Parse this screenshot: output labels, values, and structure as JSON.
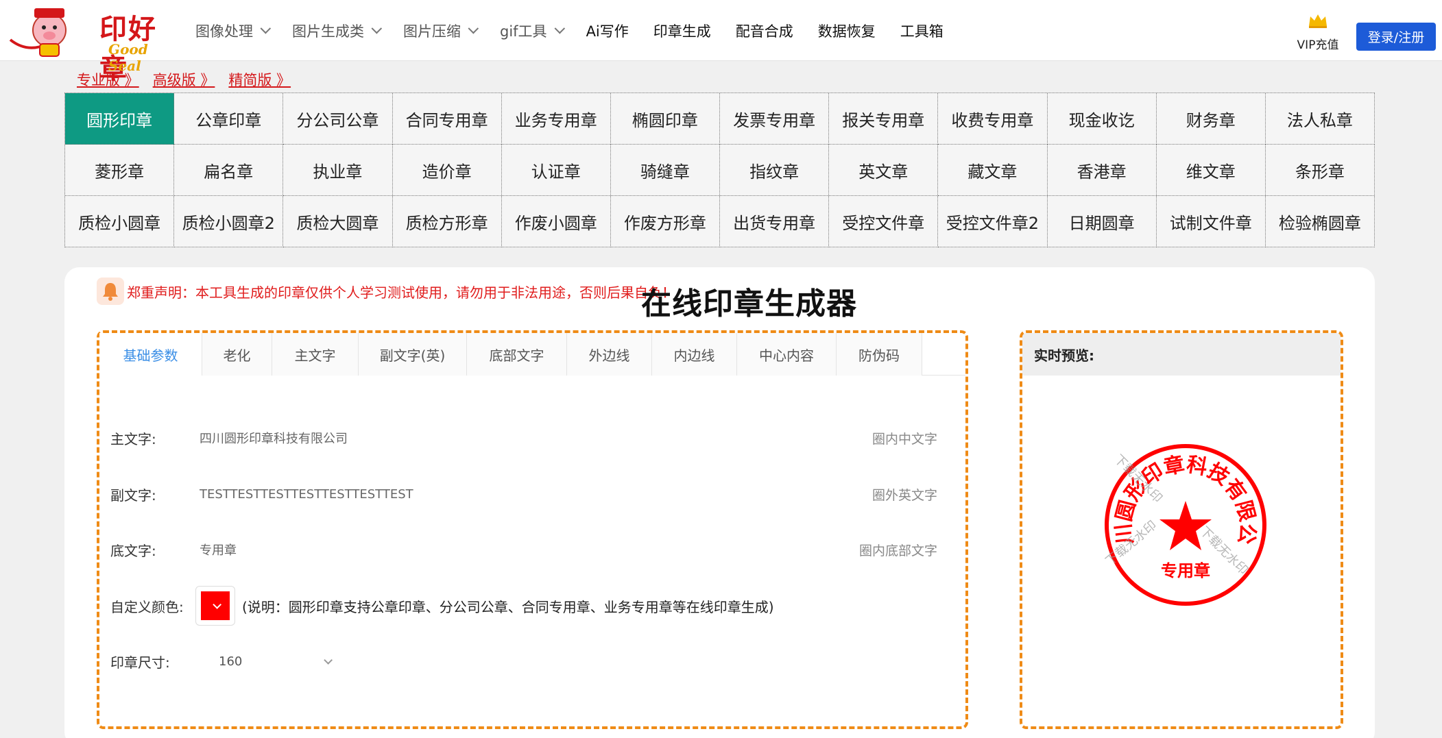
{
  "header": {
    "logo_title": "印好章",
    "logo_sub": "Good Seal",
    "nav": [
      {
        "label": "图像处理",
        "dropdown": true
      },
      {
        "label": "图片生成类",
        "dropdown": true
      },
      {
        "label": "图片压缩",
        "dropdown": true
      },
      {
        "label": "gif工具",
        "dropdown": true
      },
      {
        "label": "Ai写作",
        "dropdown": false
      },
      {
        "label": "印章生成",
        "dropdown": false
      },
      {
        "label": "配音合成",
        "dropdown": false
      },
      {
        "label": "数据恢复",
        "dropdown": false
      },
      {
        "label": "工具箱",
        "dropdown": false
      }
    ],
    "vip_label": "VIP充值",
    "login_label": "登录/注册"
  },
  "versions": [
    "专业版 》",
    "高级版 》",
    "精简版 》"
  ],
  "stamp_types": [
    "圆形印章",
    "公章印章",
    "分公司公章",
    "合同专用章",
    "业务专用章",
    "椭圆印章",
    "发票专用章",
    "报关专用章",
    "收费专用章",
    "现金收讫",
    "财务章",
    "法人私章",
    "菱形章",
    "扁名章",
    "执业章",
    "造价章",
    "认证章",
    "骑缝章",
    "指纹章",
    "英文章",
    "藏文章",
    "香港章",
    "维文章",
    "条形章",
    "质检小圆章",
    "质检小圆章2",
    "质检大圆章",
    "质检方形章",
    "作废小圆章",
    "作废方形章",
    "出货专用章",
    "受控文件章",
    "受控文件章2",
    "日期圆章",
    "试制文件章",
    "检验椭圆章"
  ],
  "active_stamp_type": "圆形印章",
  "notice": "郑重声明：本工具生成的印章仅供个人学习测试使用，请勿用于非法用途，否则后果自负！",
  "page_title": "在线印章生成器",
  "tabs": [
    "基础参数",
    "老化",
    "主文字",
    "副文字(英)",
    "底部文字",
    "外边线",
    "内边线",
    "中心内容",
    "防伪码"
  ],
  "form": {
    "main_text_label": "主文字:",
    "main_text_value": "四川圆形印章科技有限公司",
    "main_text_hint": "圈内中文字",
    "sub_text_label": "副文字:",
    "sub_text_value": "TESTTESTTESTTESTTESTTESTTEST",
    "sub_text_hint": "圈外英文字",
    "bottom_text_label": "底文字:",
    "bottom_text_value": "专用章",
    "bottom_text_hint": "圈内底部文字",
    "color_label": "自定义颜色:",
    "color_value": "#ff0000",
    "color_note": "(说明：圆形印章支持公章印章、分公司公章、合同专用章、业务专用章等在线印章生成)",
    "size_label": "印章尺寸:",
    "size_value": "160"
  },
  "preview": {
    "title": "实时预览:",
    "stamp_main_text": "四川圆形印章科技有限公司",
    "stamp_bottom_text": "专用章",
    "watermark": "下载无水印"
  },
  "colors": {
    "accent_teal": "#0e9a83",
    "brand_red": "#d4171a",
    "dash_orange": "#ef8b16",
    "login_blue": "#1d5bd8",
    "stamp_red": "#ff0000"
  }
}
